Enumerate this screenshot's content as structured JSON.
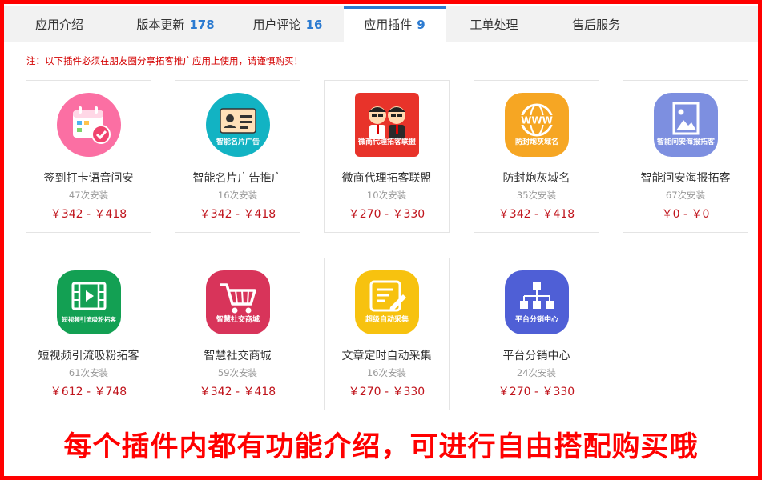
{
  "tabs": [
    {
      "label": "应用介绍",
      "count": ""
    },
    {
      "label": "版本更新",
      "count": "178"
    },
    {
      "label": "用户评论",
      "count": "16"
    },
    {
      "label": "应用插件",
      "count": "9"
    },
    {
      "label": "工单处理",
      "count": ""
    },
    {
      "label": "售后服务",
      "count": ""
    }
  ],
  "active_tab": "应用插件",
  "note": "注：以下插件必须在朋友圈分享拓客推广应用上使用，请谨慎购买！",
  "plugins": [
    {
      "name": "签到打卡语音问安",
      "installs": "47次安装",
      "price": "￥342 - ￥418",
      "icon": "calendar-check-icon",
      "icon_caption": "",
      "color": "#fb6fa3"
    },
    {
      "name": "智能名片广告推广",
      "installs": "16次安装",
      "price": "￥342 - ￥418",
      "icon": "business-card-icon",
      "icon_caption": "智能名片广告",
      "color": "#12b3c3"
    },
    {
      "name": "微商代理拓客联盟",
      "installs": "10次安装",
      "price": "￥270 - ￥330",
      "icon": "cartoon-partners-icon",
      "icon_caption": "微商代理拓客联盟",
      "color": "#e8332a"
    },
    {
      "name": "防封炮灰域名",
      "installs": "35次安装",
      "price": "￥342 - ￥418",
      "icon": "www-globe-icon",
      "icon_caption": "防封炮灰域名",
      "color": "#f6a623"
    },
    {
      "name": "智能问安海报拓客",
      "installs": "67次安装",
      "price": "￥0 - ￥0",
      "icon": "poster-image-icon",
      "icon_caption": "智能问安海报拓客",
      "color": "#7d8fe0"
    },
    {
      "name": "短视频引流吸粉拓客",
      "installs": "61次安装",
      "price": "￥612 - ￥748",
      "icon": "video-film-icon",
      "icon_caption": "短视频引流吸粉拓客",
      "color": "#13a053"
    },
    {
      "name": "智慧社交商城",
      "installs": "59次安装",
      "price": "￥342 - ￥418",
      "icon": "shopping-cart-icon",
      "icon_caption": "智慧社交商城",
      "color": "#d8345a"
    },
    {
      "name": "文章定时自动采集",
      "installs": "16次安装",
      "price": "￥270 - ￥330",
      "icon": "document-pen-icon",
      "icon_caption": "超级自动采集",
      "color": "#f7c20f"
    },
    {
      "name": "平台分销中心",
      "installs": "24次安装",
      "price": "￥270 - ￥330",
      "icon": "org-tree-icon",
      "icon_caption": "平台分销中心",
      "color": "#4f5fd6"
    }
  ],
  "banner": "每个插件内都有功能介绍，可进行自由搭配购买哦"
}
